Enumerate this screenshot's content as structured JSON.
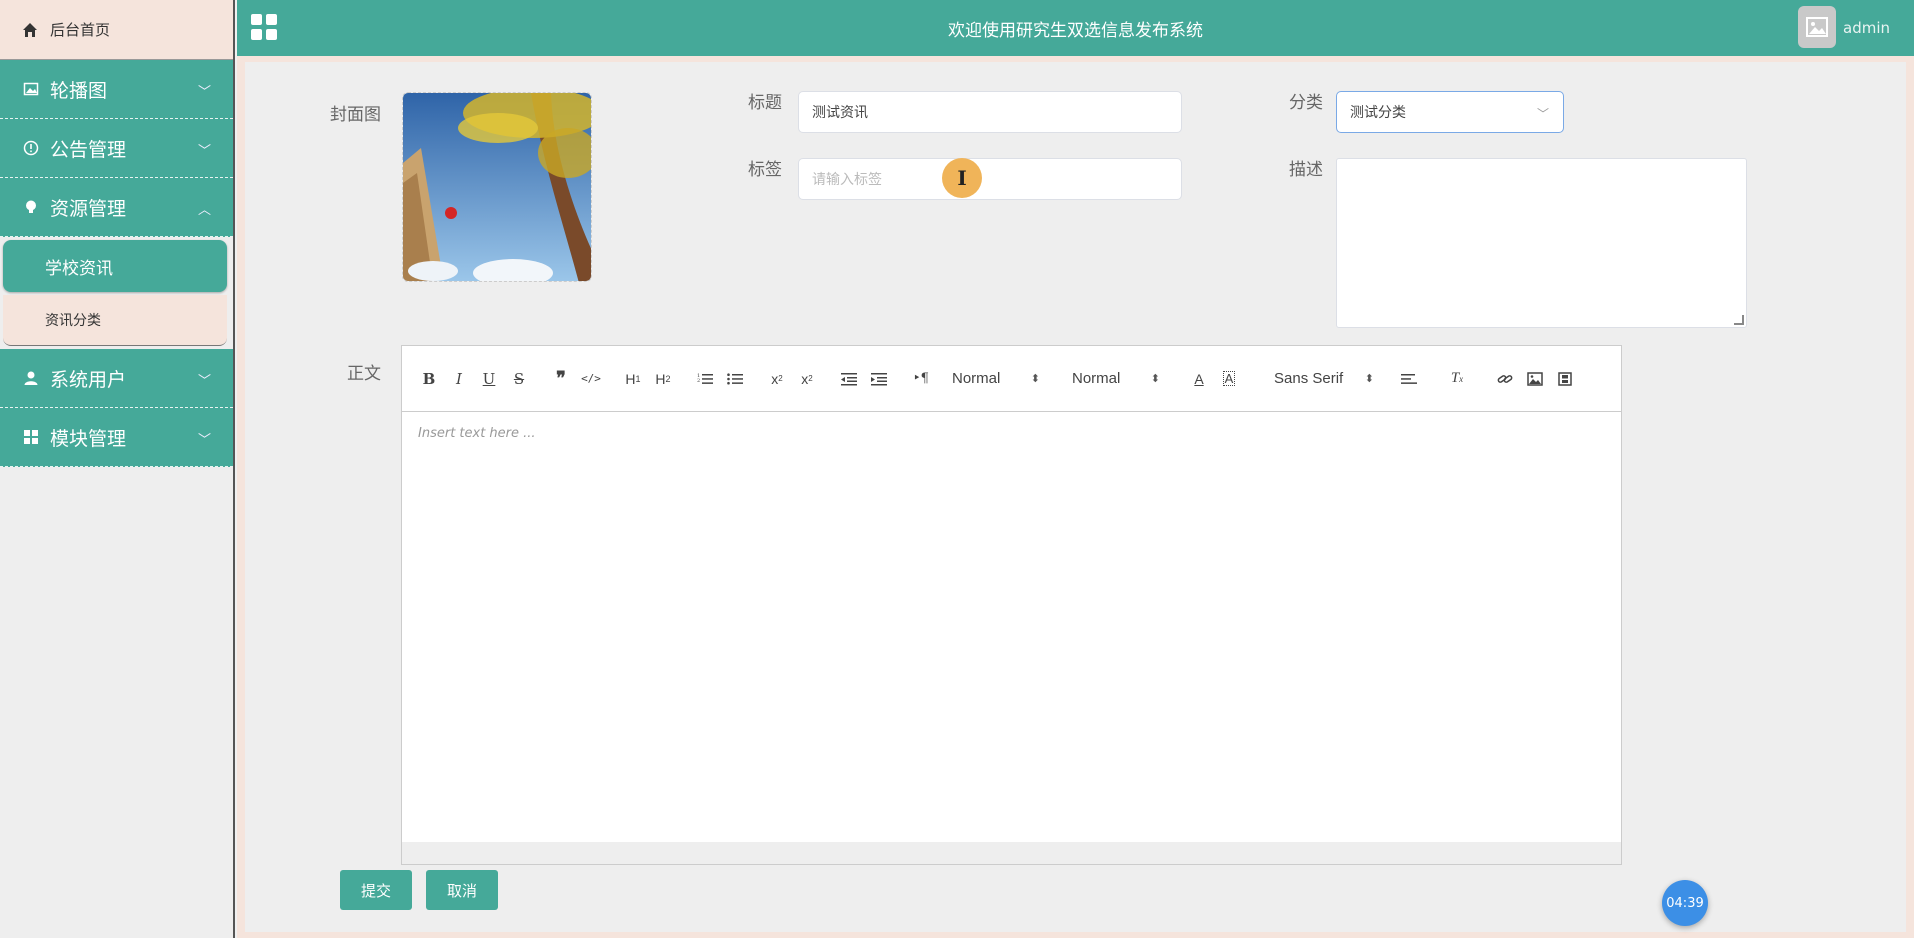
{
  "sidebar": {
    "home_label": "后台首页",
    "menus": [
      {
        "label": "轮播图",
        "icon": "image-icon",
        "expanded": false
      },
      {
        "label": "公告管理",
        "icon": "info-circle-icon",
        "expanded": false
      },
      {
        "label": "资源管理",
        "icon": "bulb-icon",
        "expanded": true
      },
      {
        "label": "系统用户",
        "icon": "user-icon",
        "expanded": false
      },
      {
        "label": "模块管理",
        "icon": "grid-icon",
        "expanded": false
      }
    ],
    "submenu": [
      {
        "label": "学校资讯",
        "active": true
      },
      {
        "label": "资讯分类",
        "active": false
      }
    ]
  },
  "header": {
    "title": "欢迎使用研究生双选信息发布系统",
    "username": "admin"
  },
  "form": {
    "cover_label": "封面图",
    "title_label": "标题",
    "title_value": "测试资讯",
    "category_label": "分类",
    "category_value": "测试分类",
    "tags_label": "标签",
    "tags_placeholder": "请输入标签",
    "description_label": "描述",
    "body_label": "正文",
    "editor_placeholder": "Insert text here ...",
    "header_select": "Normal",
    "size_select": "Normal",
    "font_select": "Sans Serif",
    "submit_label": "提交",
    "cancel_label": "取消"
  },
  "timer": "04:39",
  "colors": {
    "primary": "#45a999",
    "sidebar_light": "#f5e4dc",
    "timer": "#3c8fe6",
    "cursor": "#f0b459"
  }
}
